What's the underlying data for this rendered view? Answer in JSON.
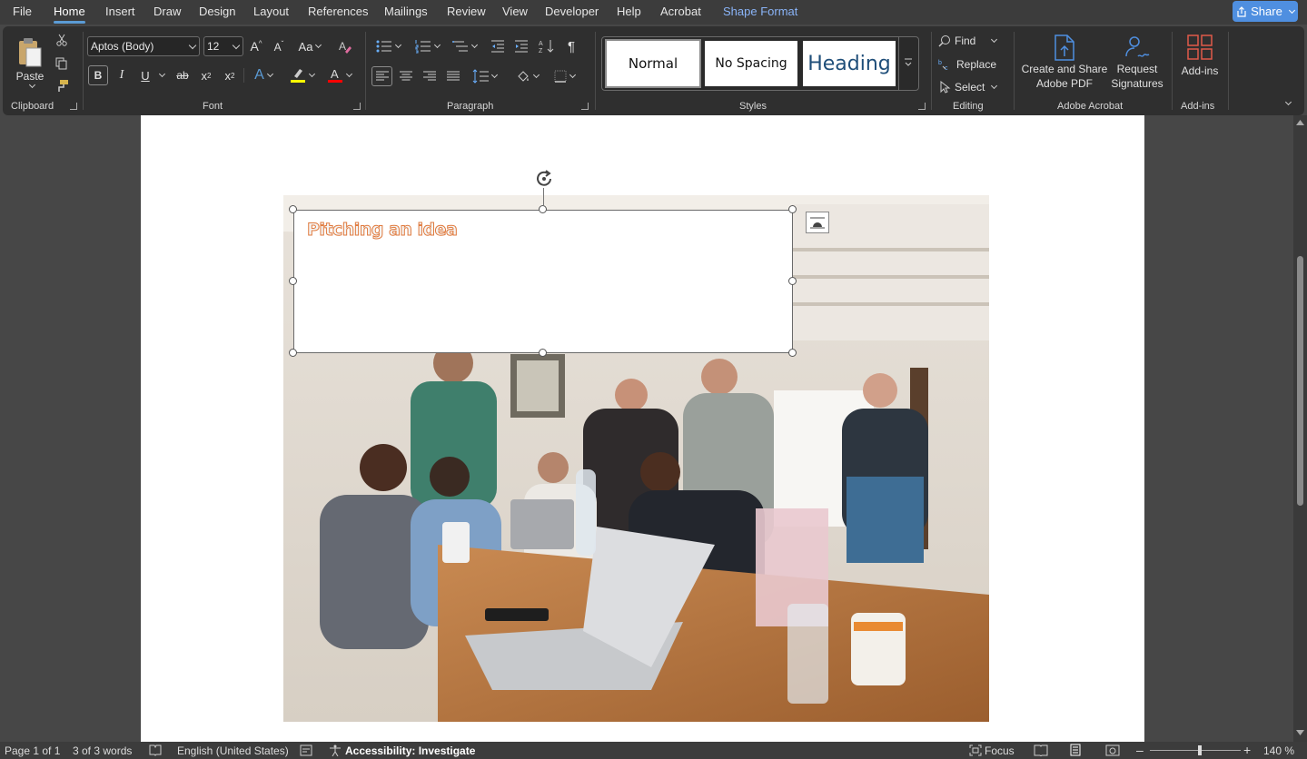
{
  "menu": {
    "tabs": [
      "File",
      "Home",
      "Insert",
      "Draw",
      "Design",
      "Layout",
      "References",
      "Mailings",
      "Review",
      "View",
      "Developer",
      "Help",
      "Acrobat",
      "Shape Format"
    ],
    "share_label": "Share"
  },
  "ribbon": {
    "clipboard": {
      "paste_label": "Paste",
      "group_label": "Clipboard"
    },
    "font": {
      "font_name": "Aptos (Body)",
      "font_size": "12",
      "change_case": "Aa",
      "bold": "B",
      "italic": "I",
      "underline": "U",
      "strike": "ab",
      "subscript": "x",
      "superscript": "x",
      "text_effects": "A",
      "font_color": "A",
      "group_label": "Font"
    },
    "paragraph": {
      "sort_icon": "sort-icon",
      "pilcrow": "¶",
      "group_label": "Paragraph"
    },
    "styles": {
      "items": [
        "Normal",
        "No Spacing",
        "Heading"
      ],
      "group_label": "Styles"
    },
    "editing": {
      "find": "Find",
      "replace": "Replace",
      "select": "Select",
      "group_label": "Editing"
    },
    "acrobat": {
      "create_share": "Create and Share",
      "create_share_2": "Adobe PDF",
      "request": "Request",
      "request_2": "Signatures",
      "group_label": "Adobe Acrobat"
    },
    "addins": {
      "label": "Add-ins",
      "group_label": "Add-ins"
    }
  },
  "document": {
    "textbox_text": "Pitching an idea"
  },
  "status": {
    "page": "Page 1 of 1",
    "words": "3 of 3 words",
    "language": "English (United States)",
    "accessibility": "Accessibility: Investigate",
    "focus": "Focus",
    "zoom": "140 %",
    "zoom_level": 1.4
  },
  "colors": {
    "accent": "#5b9bd5",
    "share": "#4f8fe0",
    "text_outline": "#e07b3f",
    "highlight": "#ffff00",
    "font_color": "#ff0000"
  }
}
